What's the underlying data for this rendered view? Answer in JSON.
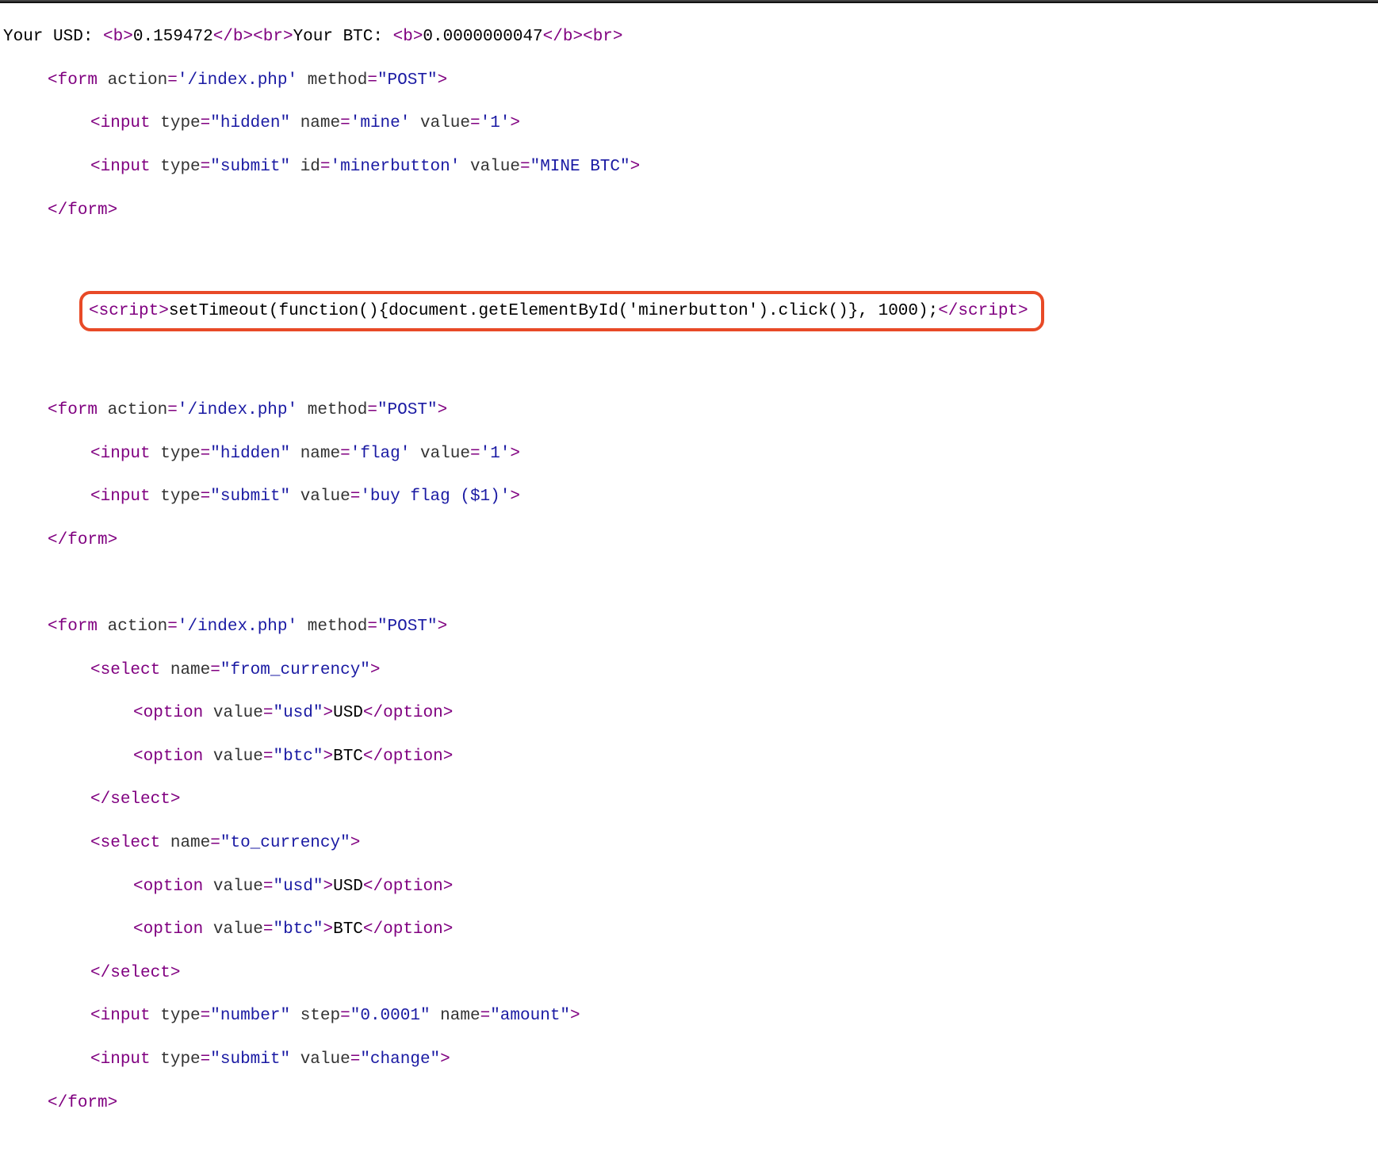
{
  "balances": {
    "usd_label": "Your USD: ",
    "usd_value": "0.159472",
    "btc_label": "Your BTC: ",
    "btc_value": "0.0000000047"
  },
  "form_mine": {
    "action": "'/index.php'",
    "method": "\"POST\"",
    "hidden_type": "\"hidden\"",
    "hidden_name": "'mine'",
    "hidden_value": "'1'",
    "submit_type": "\"submit\"",
    "submit_id": "'minerbutton'",
    "submit_value": "\"MINE BTC\""
  },
  "script_inject": {
    "code": "setTimeout(function(){document.getElementById('minerbutton').click()}, 1000);"
  },
  "form_flag": {
    "action": "'/index.php'",
    "method": "\"POST\"",
    "hidden_type": "\"hidden\"",
    "hidden_name": "'flag'",
    "hidden_value": "'1'",
    "submit_type": "\"submit\"",
    "submit_value": "'buy flag ($1)'"
  },
  "form_change": {
    "action": "'/index.php'",
    "method": "\"POST\"",
    "select_from_name": "\"from_currency\"",
    "select_to_name": "\"to_currency\"",
    "opt_usd_val": "\"usd\"",
    "opt_usd_txt": "USD",
    "opt_btc_val": "\"btc\"",
    "opt_btc_txt": "BTC",
    "num_type": "\"number\"",
    "num_step": "\"0.0001\"",
    "num_name": "\"amount\"",
    "submit_type": "\"submit\"",
    "submit_value": "\"change\""
  },
  "kw": {
    "form": "form",
    "input": "input",
    "select": "select",
    "option": "option",
    "script": "script",
    "b": "b",
    "br": "br",
    "action": "action",
    "method": "method",
    "type": "type",
    "name": "name",
    "value": "value",
    "id": "id",
    "step": "step"
  }
}
